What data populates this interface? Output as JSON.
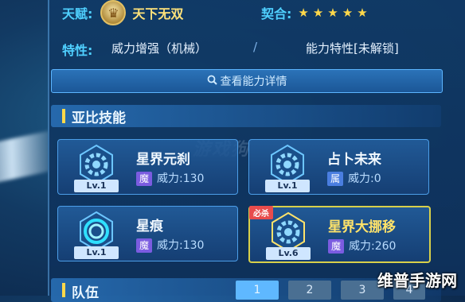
{
  "talent": {
    "label": "天赋:",
    "name": "天下无双"
  },
  "fit": {
    "label": "契合:",
    "stars": "★★★★★"
  },
  "traits": {
    "label": "特性:",
    "value": "威力增强（机械）",
    "separator": "/",
    "ability_trait": "能力特性[未解锁]"
  },
  "details_button": {
    "label": "查看能力详情"
  },
  "skills_section": {
    "title": "亚比技能"
  },
  "skills": [
    {
      "name": "星界元刹",
      "level": "Lv.1",
      "attr": "魔",
      "power": "威力:130",
      "tag": ""
    },
    {
      "name": "占卜未来",
      "level": "Lv.1",
      "attr": "属",
      "power": "威力:0",
      "tag": ""
    },
    {
      "name": "星痕",
      "level": "Lv.1",
      "attr": "魔",
      "power": "威力:130",
      "tag": ""
    },
    {
      "name": "星界大挪移",
      "level": "Lv.6",
      "attr": "魔",
      "power": "威力:260",
      "tag": "必杀"
    }
  ],
  "team_section": {
    "title": "队伍",
    "tabs": [
      "1",
      "2",
      "3",
      "4"
    ]
  },
  "watermark": "游戏狗",
  "brand": "维普手游网",
  "colors": {
    "accent": "#4fd0ff",
    "gold": "#ffd84a",
    "panel": "#103a66"
  }
}
